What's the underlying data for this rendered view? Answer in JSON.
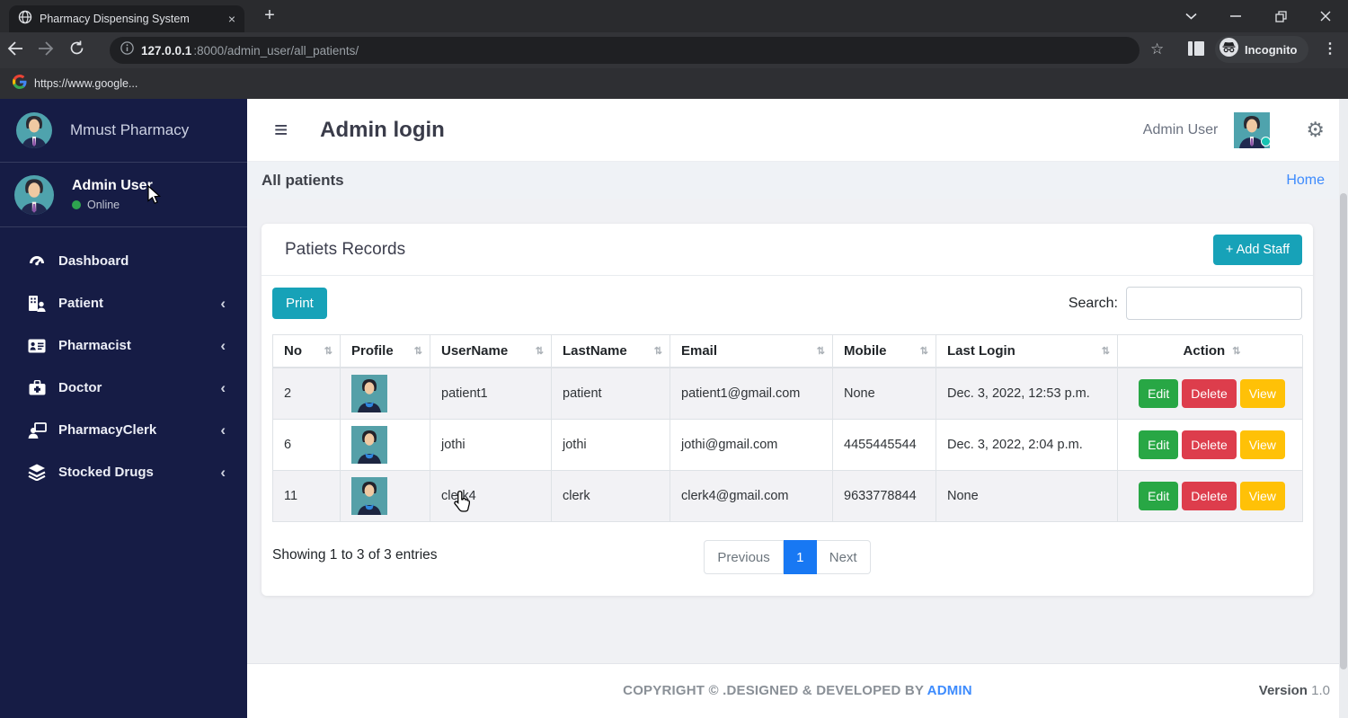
{
  "browser": {
    "tab_title": "Pharmacy Dispensing System",
    "url_primary": "127.0.0.1",
    "url_secondary": ":8000/admin_user/all_patients/",
    "bookmark_label": "https://www.google...",
    "incognito_label": "Incognito"
  },
  "icons": {
    "plus": "+",
    "close": "×",
    "hamburger": "≡",
    "gear": "⚙",
    "chevron_left": "‹",
    "sort": "⇅",
    "star": "☆",
    "menu_dots": "⋮"
  },
  "sidebar": {
    "brand": "Mmust Pharmacy",
    "user_name": "Admin User",
    "user_status": "Online",
    "items": [
      {
        "label": "Dashboard"
      },
      {
        "label": "Patient"
      },
      {
        "label": "Pharmacist"
      },
      {
        "label": "Doctor"
      },
      {
        "label": "PharmacyClerk"
      },
      {
        "label": "Stocked Drugs"
      }
    ]
  },
  "header": {
    "title": "Admin login",
    "user_name": "Admin User"
  },
  "breadcrumb": {
    "title": "All patients",
    "home": "Home"
  },
  "card": {
    "title": "Patiets Records",
    "add_button": "+ Add Staff",
    "print_button": "Print",
    "search_label": "Search:"
  },
  "table": {
    "columns": [
      "No",
      "Profile",
      "UserName",
      "LastName",
      "Email",
      "Mobile",
      "Last Login",
      "Action"
    ],
    "action_buttons": [
      "Edit",
      "Delete",
      "View"
    ],
    "rows": [
      {
        "no": "2",
        "username": "patient1",
        "lastname": "patient",
        "email": "patient1@gmail.com",
        "mobile": "None",
        "last_login": "Dec. 3, 2022, 12:53 p.m."
      },
      {
        "no": "6",
        "username": "jothi",
        "lastname": "jothi",
        "email": "jothi@gmail.com",
        "mobile": "4455445544",
        "last_login": "Dec. 3, 2022, 2:04 p.m."
      },
      {
        "no": "11",
        "username": "clerk4",
        "lastname": "clerk",
        "email": "clerk4@gmail.com",
        "mobile": "9633778844",
        "last_login": "None"
      }
    ],
    "summary": "Showing 1 to 3 of 3 entries",
    "pagination": {
      "previous": "Previous",
      "current": "1",
      "next": "Next"
    }
  },
  "footer": {
    "copyright_prefix": "COPYRIGHT © .DESIGNED & DEVELOPED BY ",
    "copyright_link": "ADMIN",
    "version_label": "Version",
    "version_value": "1.0"
  },
  "colors": {
    "sidebar_bg": "#161c45",
    "teal_button": "#17a2b8",
    "edit_green": "#28a745",
    "delete_red": "#dd3d4c",
    "view_yellow": "#ffc107",
    "link_blue": "#3d8bfd",
    "pagination_blue": "#1878f3",
    "online_green": "#2ea44f"
  }
}
